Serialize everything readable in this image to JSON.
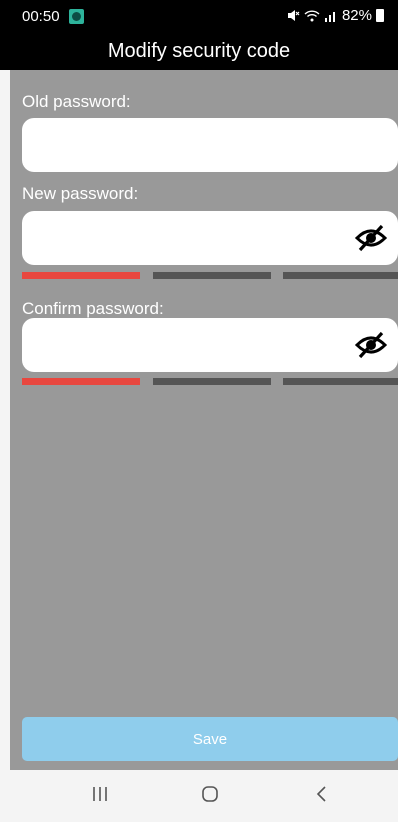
{
  "status_bar": {
    "time": "00:50",
    "battery": "82%",
    "icons": [
      "mute-icon",
      "wifi-icon",
      "signal-icon",
      "battery-icon"
    ]
  },
  "header": {
    "title": "Modify security code"
  },
  "form": {
    "old_password": {
      "label": "Old password:",
      "value": ""
    },
    "new_password": {
      "label": "New password:",
      "value": "",
      "strength_segments_filled": 1,
      "strength_segments_total": 3
    },
    "confirm_password": {
      "label": "Confirm password:",
      "value": "",
      "strength_segments_filled": 1,
      "strength_segments_total": 3
    }
  },
  "save_label": "Save",
  "navigation": {
    "buttons": [
      "recent-apps-icon",
      "home-icon",
      "back-icon"
    ]
  },
  "colors": {
    "background": "#999999",
    "header": "#000000",
    "strength_weak": "#e8473f",
    "strength_empty": "#555555",
    "save_button": "#8fcdec"
  }
}
